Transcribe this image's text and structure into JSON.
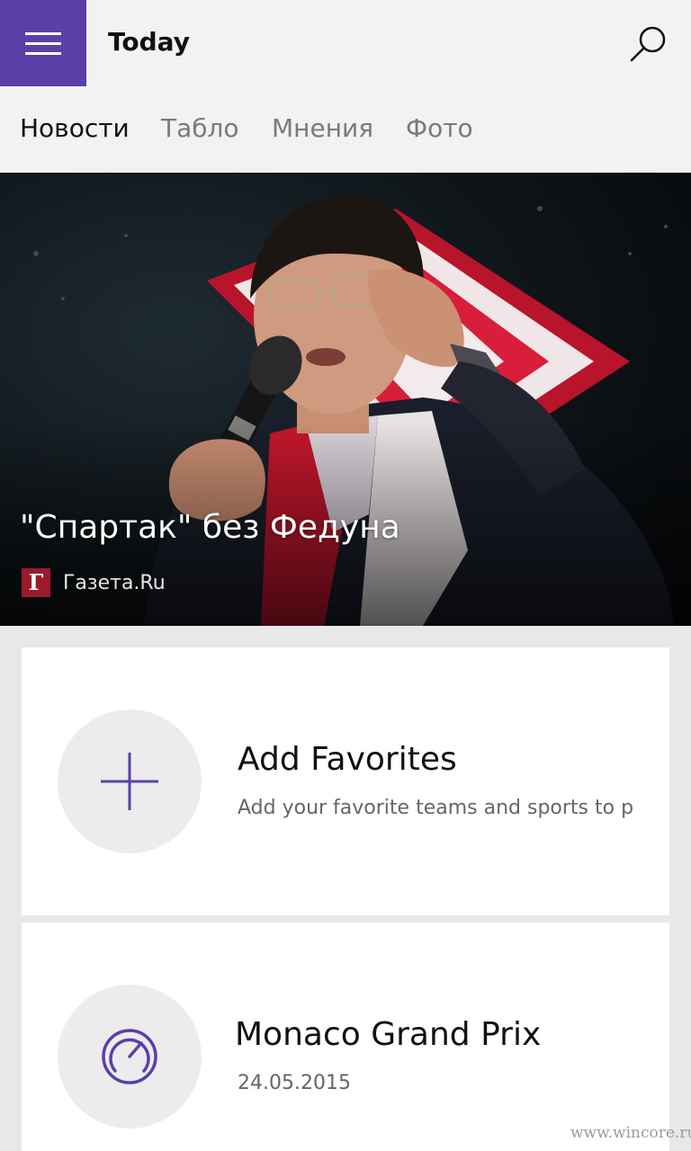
{
  "app": {
    "title": "Today"
  },
  "tabs": [
    {
      "label": "Новости",
      "active": true
    },
    {
      "label": "Табло",
      "active": false
    },
    {
      "label": "Мнения",
      "active": false
    },
    {
      "label": "Фото",
      "active": false
    }
  ],
  "hero": {
    "title": "\"Спартак\" без Федуна",
    "source_logo_letter": "Г",
    "source_name": "Газета.Ru"
  },
  "cards": [
    {
      "title": "Add Favorites",
      "subtitle": "Add your favorite teams and sports to p...",
      "icon": "plus-icon"
    },
    {
      "title": "Monaco Grand Prix",
      "subtitle": "24.05.2015",
      "icon": "speedometer-icon"
    }
  ],
  "watermark": "www.wincore.ru",
  "colors": {
    "accent": "#5b3fa8",
    "appbar_bg": "#f2f2f2",
    "page_bg": "#e8e8e8"
  }
}
